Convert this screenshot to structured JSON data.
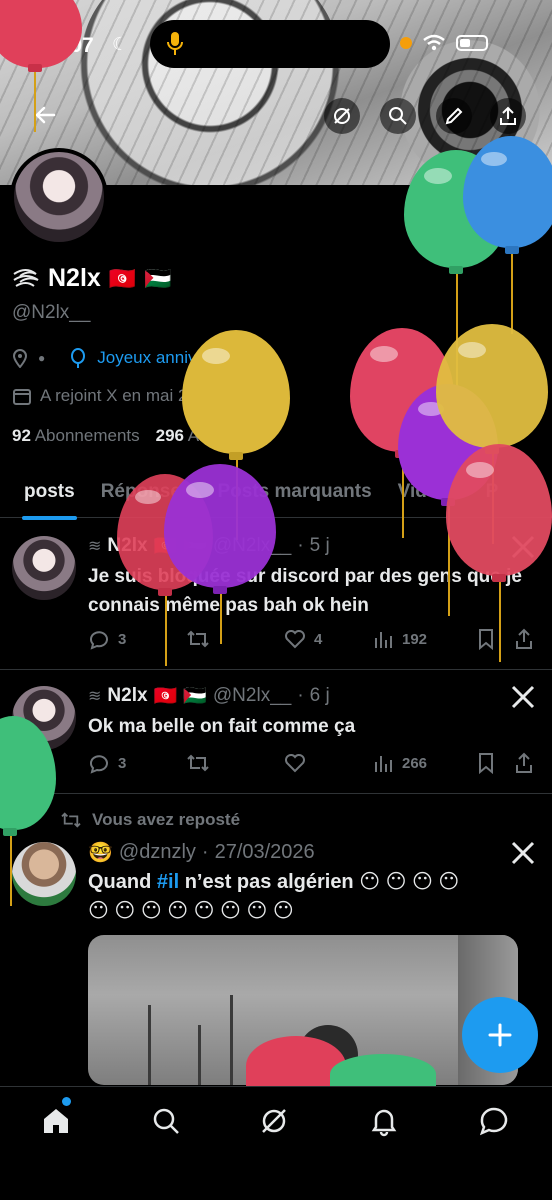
{
  "status_bar": {
    "time": "00:07"
  },
  "profile": {
    "display_name": "N2lx",
    "name_prefix_icon": "wind-swirl-icon",
    "flags": [
      "🇹🇳",
      "🇵🇸"
    ],
    "handle": "@N2lx__",
    "location_icon": "location-pin-icon",
    "birthday_text": "Joyeux anniversaire !",
    "joined": "A rejoint X en mai 2020",
    "following_count": "92",
    "following_label": "Abonnements",
    "followers_count": "296",
    "followers_label": "Abonnés"
  },
  "tabs": [
    "posts",
    "Réponses",
    "Posts marquants",
    "Vidéos",
    "P"
  ],
  "posts": [
    {
      "name": "N2lx",
      "handle": "@N2lx__",
      "time": "5 j",
      "text": "Je suis bloquée sur discord par des gens que je connais même pas bah ok hein",
      "replies": "3",
      "reposts": "",
      "likes": "4",
      "views": "192"
    },
    {
      "name": "N2lx",
      "handle": "@N2lx__",
      "time": "6 j",
      "text": "Ok ma belle on fait comme ça",
      "replies": "3",
      "reposts": "",
      "likes": "",
      "views": "266"
    },
    {
      "repost_note": "Vous avez reposté",
      "name_emoji": "🤓",
      "handle": "@dznzly",
      "time": "27/03/2026",
      "text_before": "Quand ",
      "hashtag": "#il",
      "text_after": " n’est pas algérien 😶 😶 😶 😶",
      "text_line2": "😶 😶 😶 😶 😶 😶 😶 😶"
    }
  ],
  "colors": {
    "accent": "#1d9bf0",
    "muted": "#71767b",
    "text": "#e7e9ea",
    "background": "#000000"
  },
  "nav": [
    "home-icon",
    "search-icon",
    "grok-icon",
    "notifications-icon",
    "messages-icon"
  ]
}
